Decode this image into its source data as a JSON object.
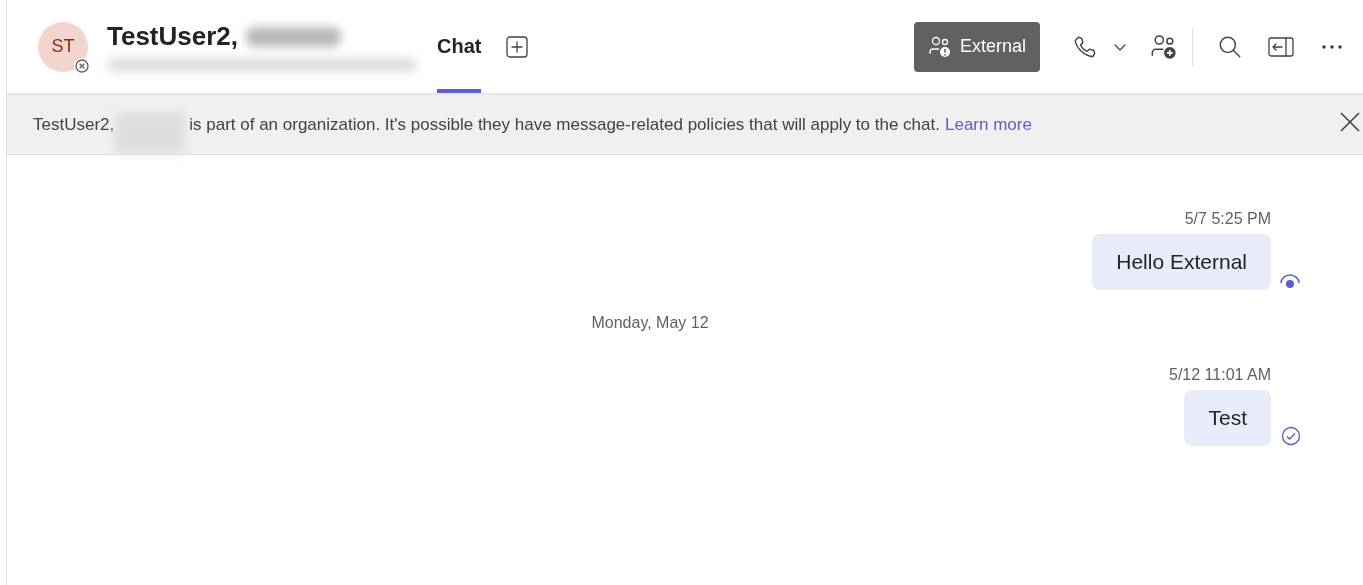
{
  "header": {
    "avatar_initials": "ST",
    "title": "TestUser2,",
    "tabs": [
      {
        "label": "Chat",
        "selected": true
      }
    ],
    "external_button": "External"
  },
  "banner": {
    "text": "TestUser2,",
    "text_after": "is part of an organization. It's possible they have message-related policies that will apply to the chat.",
    "link": "Learn more"
  },
  "messages": [
    {
      "kind": "message",
      "time": "5/7 5:25 PM",
      "text": "Hello External",
      "seen": true
    },
    {
      "kind": "divider",
      "text": "Monday, May 12"
    },
    {
      "kind": "message",
      "time": "5/12 11:01 AM",
      "text": "Test",
      "seen": false
    }
  ]
}
